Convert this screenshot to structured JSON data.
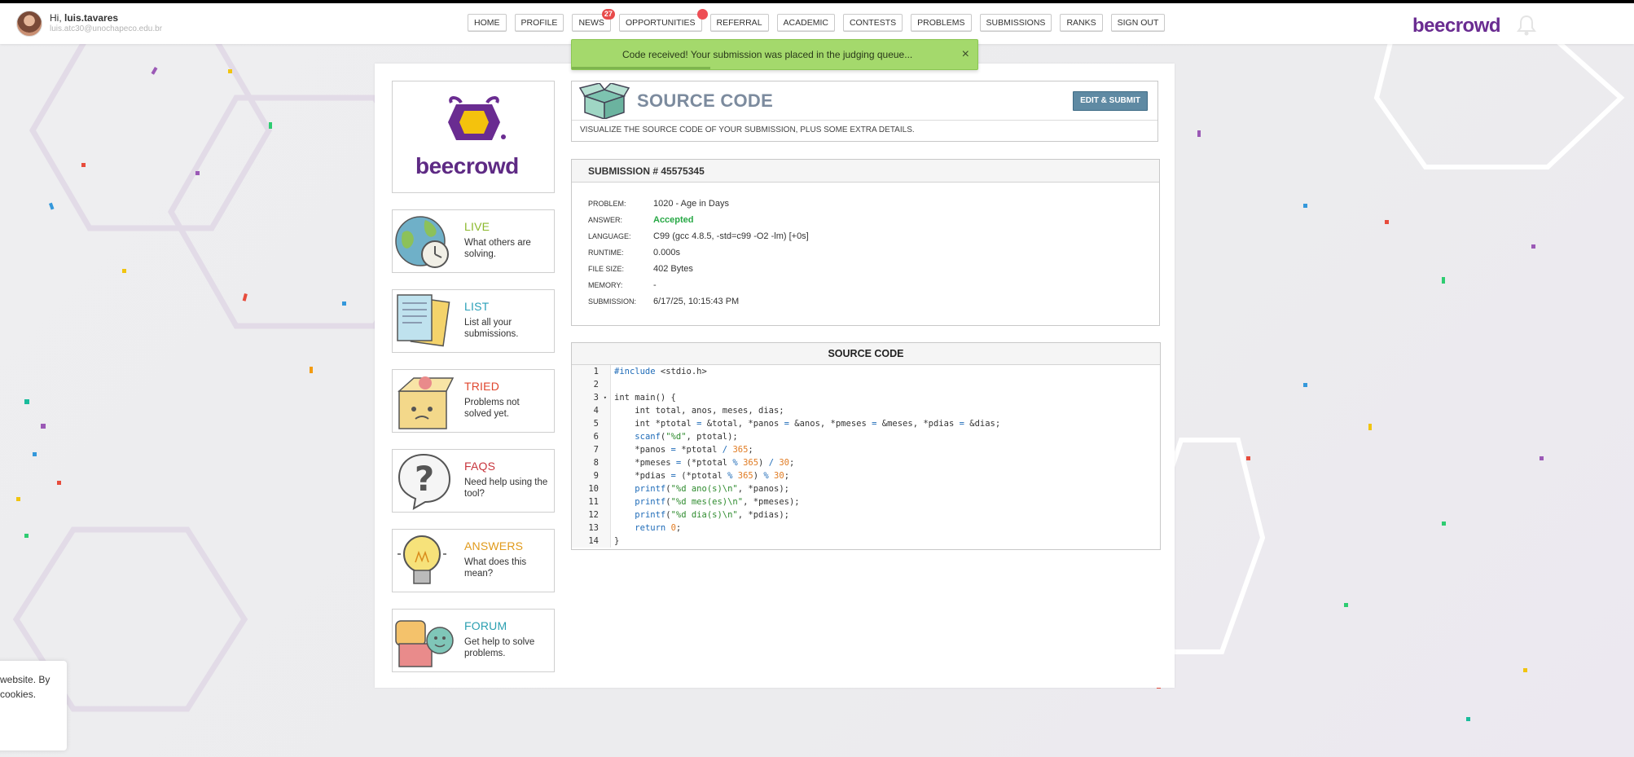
{
  "header": {
    "greeting_prefix": "Hi,",
    "username": "luis.tavares",
    "email": "luis.atc30@unochapeco.edu.br",
    "brand": "beecrowd",
    "nav": [
      {
        "label": "HOME"
      },
      {
        "label": "PROFILE"
      },
      {
        "label": "NEWS",
        "badge": "27"
      },
      {
        "label": "OPPORTUNITIES"
      },
      {
        "label": "REFERRAL"
      },
      {
        "label": "ACADEMIC"
      },
      {
        "label": "CONTESTS"
      },
      {
        "label": "PROBLEMS"
      },
      {
        "label": "SUBMISSIONS"
      },
      {
        "label": "RANKS"
      },
      {
        "label": "SIGN OUT"
      }
    ]
  },
  "toast": {
    "message": "Code received! Your submission was placed in the judging queue...",
    "close": "×"
  },
  "sidebar": {
    "logo_text": "beecrowd",
    "items": [
      {
        "title": "LIVE",
        "desc": "What others are solving.",
        "color": "#8bb82b"
      },
      {
        "title": "LIST",
        "desc": "List all your submissions.",
        "color": "#2aa0b8"
      },
      {
        "title": "TRIED",
        "desc": "Problems not solved yet.",
        "color": "#e0462e"
      },
      {
        "title": "FAQS",
        "desc": "Need help using the tool?",
        "color": "#c8353d"
      },
      {
        "title": "ANSWERS",
        "desc": "What does this mean?",
        "color": "#e09a1b"
      },
      {
        "title": "FORUM",
        "desc": "Get help to solve problems.",
        "color": "#2a9fb0"
      }
    ]
  },
  "panel": {
    "title": "SOURCE CODE",
    "edit_button": "EDIT & SUBMIT",
    "subtitle": "VISUALIZE THE SOURCE CODE OF YOUR SUBMISSION, PLUS SOME EXTRA DETAILS."
  },
  "submission": {
    "heading": "SUBMISSION # 45575345",
    "rows": [
      {
        "label": "PROBLEM:",
        "value": "1020 - Age in Days"
      },
      {
        "label": "ANSWER:",
        "value": "Accepted"
      },
      {
        "label": "LANGUAGE:",
        "value": "C99 (gcc 4.8.5, -std=c99 -O2 -lm) [+0s]"
      },
      {
        "label": "RUNTIME:",
        "value": "0.000s"
      },
      {
        "label": "FILE SIZE:",
        "value": "402 Bytes"
      },
      {
        "label": "MEMORY:",
        "value": "-"
      },
      {
        "label": "SUBMISSION:",
        "value": "6/17/25, 10:15:43 PM"
      }
    ]
  },
  "source": {
    "heading": "SOURCE CODE",
    "line_numbers": [
      "1",
      "2",
      "3",
      "4",
      "5",
      "6",
      "7",
      "8",
      "9",
      "10",
      "11",
      "12",
      "13",
      "14"
    ],
    "lines": [
      "#include <stdio.h>",
      "",
      "int main() {",
      "    int total, anos, meses, dias;",
      "    int *ptotal = &total, *panos = &anos, *pmeses = &meses, *pdias = &dias;",
      "    scanf(\"%d\", ptotal);",
      "    *panos = *ptotal / 365;",
      "    *pmeses = (*ptotal % 365) / 30;",
      "    *pdias = (*ptotal % 365) % 30;",
      "    printf(\"%d ano(s)\\n\", *panos);",
      "    printf(\"%d mes(es)\\n\", *pmeses);",
      "    printf(\"%d dia(s)\\n\", *pdias);",
      "    return 0;",
      "}"
    ]
  },
  "cookie": {
    "line1": "website. By",
    "line2": "cookies."
  },
  "colors": {
    "brand": "#6a2c91",
    "toast_bg": "#a4d96c",
    "accepted": "#27a845",
    "edit_button": "#5f8aa3",
    "badge": "#e84b4b"
  }
}
